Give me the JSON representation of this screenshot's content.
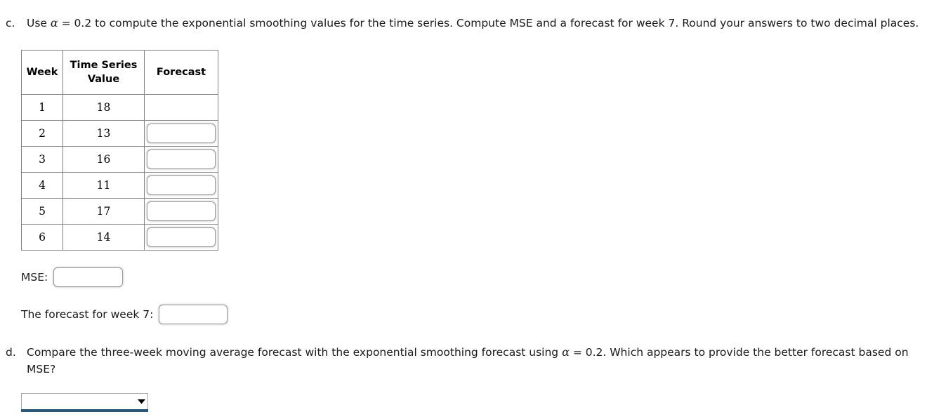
{
  "questions": {
    "c": {
      "marker": "c.",
      "text_before_alpha": "Use ",
      "alpha_symbol": "α",
      "text_after_alpha": " = 0.2 to compute the exponential smoothing values for the time series. Compute MSE and a forecast for week 7. Round your answers to two decimal places."
    },
    "d": {
      "marker": "d.",
      "text_before_alpha": "Compare the three-week moving average forecast with the exponential smoothing forecast using ",
      "alpha_symbol": "α",
      "text_after_alpha": " = 0.2. Which appears to provide the better forecast based on MSE?"
    }
  },
  "table": {
    "headers": {
      "week": "Week",
      "value_line1": "Time Series",
      "value_line2": "Value",
      "forecast": "Forecast"
    },
    "rows": [
      {
        "week": "1",
        "value": "18",
        "forecast": "",
        "has_input": false
      },
      {
        "week": "2",
        "value": "13",
        "forecast": "",
        "has_input": true
      },
      {
        "week": "3",
        "value": "16",
        "forecast": "",
        "has_input": true
      },
      {
        "week": "4",
        "value": "11",
        "forecast": "",
        "has_input": true
      },
      {
        "week": "5",
        "value": "17",
        "forecast": "",
        "has_input": true
      },
      {
        "week": "6",
        "value": "14",
        "forecast": "",
        "has_input": true
      }
    ]
  },
  "mse": {
    "label": "MSE:",
    "value": "",
    "placeholder": ""
  },
  "week7": {
    "label": "The forecast for week 7:",
    "value": "",
    "placeholder": ""
  },
  "dropdown": {
    "selected": "",
    "icon": "chevron-down-icon"
  },
  "colors": {
    "text": "#1a1a1a",
    "table_border": "#818181",
    "input_border": "#9a9a9a",
    "dropdown_underline": "#2c5777",
    "background": "#ffffff"
  }
}
